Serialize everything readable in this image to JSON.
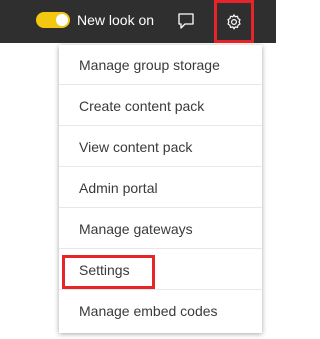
{
  "header": {
    "toggle_label": "New look on",
    "toggle_state": "on",
    "toggle_color": "#f2c811",
    "chat_icon": "chat-icon",
    "settings_icon": "gear-icon",
    "background": "#2f2f2f"
  },
  "menu": {
    "items": [
      {
        "label": "Manage group storage"
      },
      {
        "label": "Create content pack"
      },
      {
        "label": "View content pack"
      },
      {
        "label": "Admin portal"
      },
      {
        "label": "Manage gateways"
      },
      {
        "label": "Settings",
        "highlighted": true
      },
      {
        "label": "Manage embed codes"
      }
    ]
  },
  "highlight_color": "#e8242b"
}
